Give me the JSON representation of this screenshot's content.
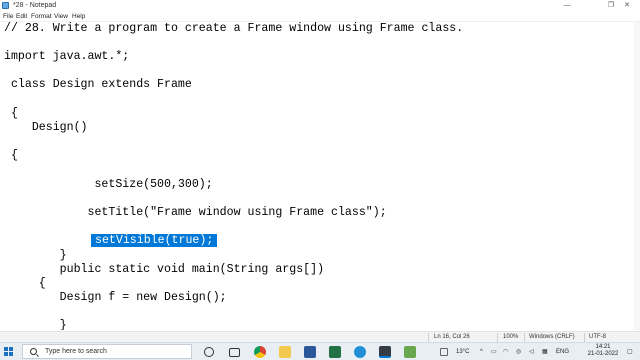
{
  "window": {
    "title": "*28 - Notepad",
    "minimize": "—",
    "maximize": "❐",
    "close": "✕"
  },
  "menu": {
    "items": [
      "File",
      "Edit",
      "Format",
      "View",
      "Help"
    ]
  },
  "editor": {
    "lines": [
      "// 28. Write a program to create a Frame window using Frame class.",
      "import java.awt.*;",
      " class Design extends Frame",
      " {",
      "    Design()",
      " {",
      "             setSize(500,300);",
      "            setTitle(\"Frame window using Frame class\");",
      "setVisible(true);",
      "        }",
      "        public static void main(String args[])",
      "     {",
      "        Design f = new Design();",
      "        }"
    ],
    "selected_text": "setVisible(true);"
  },
  "status": {
    "position": "Ln 16, Col 26",
    "zoom": "100%",
    "line_ending": "Windows (CRLF)",
    "encoding": "UTF-8"
  },
  "taskbar": {
    "search_placeholder": "Type here to search",
    "temperature": "13°C",
    "language": "ENG",
    "time": "14:21",
    "date": "21-01-2022",
    "icons": [
      "task-view",
      "file-explorer",
      "chrome",
      "folder",
      "word",
      "excel",
      "edge",
      "photos",
      "notepad"
    ]
  },
  "colors": {
    "selection": "#0078d7",
    "taskbar": "#e8eef4"
  }
}
